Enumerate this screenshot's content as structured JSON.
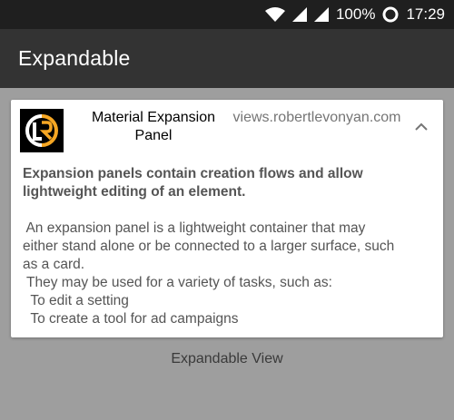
{
  "status_bar": {
    "battery": "100%",
    "time": "17:29",
    "icons": [
      "wifi-icon",
      "signal-icon",
      "signal-icon",
      "battery-circle-icon"
    ]
  },
  "app_bar": {
    "title": "Expandable"
  },
  "panel": {
    "logo_icon": "lr-logo-icon",
    "title": "Material Expansion Panel",
    "subtitle": "views.robertlevonyan.com",
    "toggle_icon": "chevron-up-icon",
    "bold_text": "Expansion panels contain creation flows and allow lightweight editing of an element.",
    "body_lines": [
      " An expansion panel is a lightweight container that may",
      "either stand alone or be connected to a larger surface, such",
      "as a card.",
      " They may be used for a variety of tasks, such as:",
      "  To edit a setting",
      "  To create a tool for ad campaigns"
    ]
  },
  "footer": {
    "label": "Expandable View"
  },
  "colors": {
    "status_bar": "#1f1f1f",
    "app_bar": "#333333",
    "background": "#9e9e9e",
    "card": "#ffffff",
    "logo_accent": "#f5a623"
  }
}
